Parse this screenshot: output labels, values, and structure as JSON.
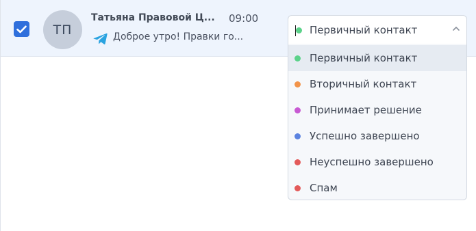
{
  "conversation": {
    "checked": true,
    "avatar_initials": "ТП",
    "name": "Татьяна Правовой Ц...",
    "time": "09:00",
    "channel_icon": "telegram-icon",
    "preview": "Доброе утро! Правки го..."
  },
  "status_select": {
    "value": "Первичный контакт",
    "value_color": "#5cd28a",
    "expanded": true
  },
  "status_options": [
    {
      "label": "Первичный контакт",
      "color": "#5cd28a",
      "active": true
    },
    {
      "label": "Вторичный контакт",
      "color": "#f2944a",
      "active": false
    },
    {
      "label": "Принимает решение",
      "color": "#c85ad3",
      "active": false
    },
    {
      "label": "Успешно завершено",
      "color": "#5c83e0",
      "active": false
    },
    {
      "label": "Неуспешно завершено",
      "color": "#e35a5a",
      "active": false
    },
    {
      "label": "Спам",
      "color": "#e35a5a",
      "active": false
    }
  ],
  "colors": {
    "accent": "#2f6fdc",
    "row_selected_bg": "#eef4fd",
    "telegram": "#2aa3e0"
  }
}
